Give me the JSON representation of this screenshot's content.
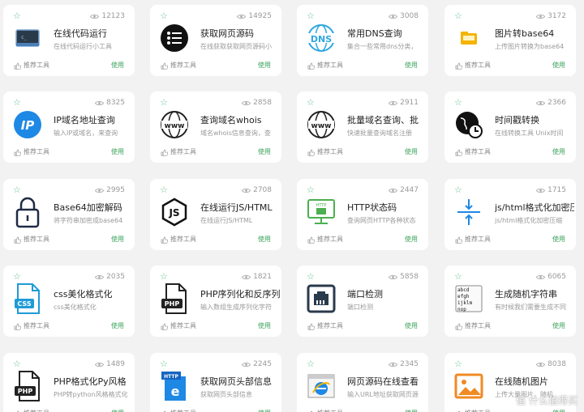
{
  "common": {
    "recommend_label": "推荐工具",
    "use_label": "使用"
  },
  "accent": "#3aa35b",
  "watermark": "值 什么值得买",
  "cards": [
    {
      "title": "在线代码运行",
      "desc": "在线代码运行小工具",
      "views": "12123",
      "icon": "terminal-icon"
    },
    {
      "title": "获取网页源码",
      "desc": "在线获取获取网页源码小",
      "views": "14925",
      "icon": "source-list-icon"
    },
    {
      "title": "常用DNS查询",
      "desc": "集合一些常用dns分类，",
      "views": "3008",
      "icon": "dns-icon"
    },
    {
      "title": "图片转base64",
      "desc": "上传图片转换为base64",
      "views": "3172",
      "icon": "image-folder-icon"
    },
    {
      "title": "IP域名地址查询",
      "desc": "输入IP或域名，来查询",
      "views": "8325",
      "icon": "ip-icon"
    },
    {
      "title": "查询域名whois",
      "desc": "域名whois信息查询，查",
      "views": "2858",
      "icon": "www-globe-icon"
    },
    {
      "title": "批量域名查询、批",
      "desc": "快速批量查询域名注册",
      "views": "2911",
      "icon": "www-globe-icon"
    },
    {
      "title": "时间戳转换",
      "desc": "在线转换工具 Unix时间",
      "views": "2366",
      "icon": "globe-clock-icon"
    },
    {
      "title": "Base64加密解码",
      "desc": "将字符串加密成base64",
      "views": "2995",
      "icon": "padlock-icon"
    },
    {
      "title": "在线运行JS/HTML",
      "desc": "在线运行JS/HTML",
      "views": "2708",
      "icon": "js-hexagon-icon"
    },
    {
      "title": "HTTP状态码",
      "desc": "查询网页HTTP各种状态",
      "views": "2447",
      "icon": "http-monitor-icon"
    },
    {
      "title": "js/html格式化加密压",
      "desc": "js/html格式化加密压缩",
      "views": "1715",
      "icon": "compress-icon"
    },
    {
      "title": "css美化格式化",
      "desc": "css美化格式化",
      "views": "2035",
      "icon": "css-file-icon"
    },
    {
      "title": "PHP序列化和反序列",
      "desc": "输入数组生成序列化字符",
      "views": "1821",
      "icon": "php-file-icon"
    },
    {
      "title": "端口检测",
      "desc": "端口检测",
      "views": "5858",
      "icon": "ethernet-port-icon"
    },
    {
      "title": "生成随机字符串",
      "desc": "有时候我们需要生成不同",
      "views": "6065",
      "icon": "text-document-icon"
    },
    {
      "title": "PHP格式化Py风格",
      "desc": "PHP转python风格格式化",
      "views": "1489",
      "icon": "php-file-icon"
    },
    {
      "title": "获取网页头部信息",
      "desc": "获取网页头部信息",
      "views": "2245",
      "icon": "http-header-icon"
    },
    {
      "title": "网页源码在线查看",
      "desc": "输入URL地址获取网页源",
      "views": "2345",
      "icon": "browser-ie-icon"
    },
    {
      "title": "在线随机图片",
      "desc": "上传大量图片，随机",
      "views": "8038",
      "icon": "picture-icon"
    }
  ]
}
